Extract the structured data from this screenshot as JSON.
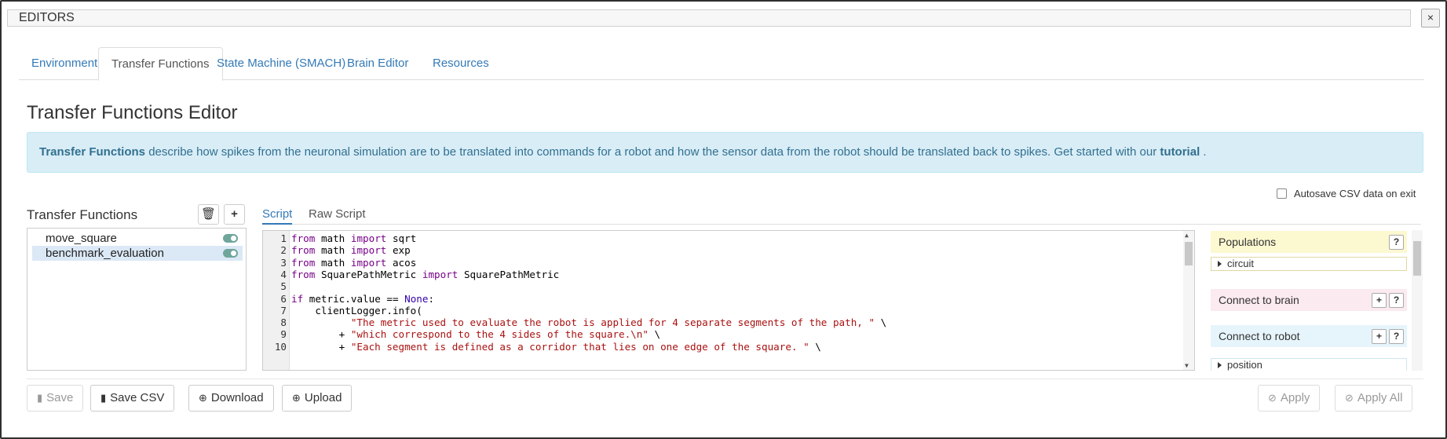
{
  "window": {
    "title": "EDITORS",
    "close_label": "×"
  },
  "tabs": [
    {
      "label": "Environment"
    },
    {
      "label": "Transfer Functions"
    },
    {
      "label": "State Machine (SMACH)"
    },
    {
      "label": "Brain Editor"
    },
    {
      "label": "Resources"
    }
  ],
  "page": {
    "title": "Transfer Functions Editor",
    "info_strong": "Transfer Functions",
    "info_text": " describe how spikes from the neuronal simulation are to be translated into commands for a robot and how the sensor data from the robot should be translated back to spikes. Get started with our ",
    "info_link": "tutorial",
    "info_end": " ."
  },
  "autosave": {
    "label": "Autosave CSV data on exit",
    "checked": false
  },
  "tf_panel": {
    "title": "Transfer Functions",
    "delete_icon": "trash-icon",
    "add_icon": "plus-icon",
    "items": [
      {
        "name": "move_square",
        "enabled": true
      },
      {
        "name": "benchmark_evaluation",
        "enabled": true,
        "selected": true
      }
    ]
  },
  "script_tabs": [
    {
      "label": "Script"
    },
    {
      "label": "Raw Script"
    }
  ],
  "code_lines": [
    {
      "n": "1",
      "text": "from math import sqrt"
    },
    {
      "n": "2",
      "text": "from math import exp"
    },
    {
      "n": "3",
      "text": "from math import acos"
    },
    {
      "n": "4",
      "text": "from SquarePathMetric import SquarePathMetric"
    },
    {
      "n": "5",
      "text": ""
    },
    {
      "n": "6",
      "text": "if metric.value == None:"
    },
    {
      "n": "7",
      "text": "    clientLogger.info("
    },
    {
      "n": "8",
      "text": "          \"The metric used to evaluate the robot is applied for 4 separate segments of the path, \" \\"
    },
    {
      "n": "9",
      "text": "        + \"which correspond to the 4 sides of the square.\\n\" \\"
    },
    {
      "n": "10",
      "text": "        + \"Each segment is defined as a corridor that lies on one edge of the square. \" \\"
    }
  ],
  "side_panel": {
    "populations": {
      "title": "Populations",
      "help": "?",
      "items": [
        "circuit"
      ]
    },
    "connect_brain": {
      "title": "Connect to brain",
      "add": "+",
      "help": "?"
    },
    "connect_robot": {
      "title": "Connect to robot",
      "add": "+",
      "help": "?",
      "items": [
        "position"
      ]
    }
  },
  "buttons": {
    "save": "Save",
    "save_csv": "Save CSV",
    "download": "Download",
    "upload": "Upload",
    "apply": "Apply",
    "apply_all": "Apply All"
  },
  "colors": {
    "accent": "#337ab7",
    "info_bg": "#d9edf7",
    "info_text": "#31708f",
    "toggle_on": "#6fa59b"
  }
}
